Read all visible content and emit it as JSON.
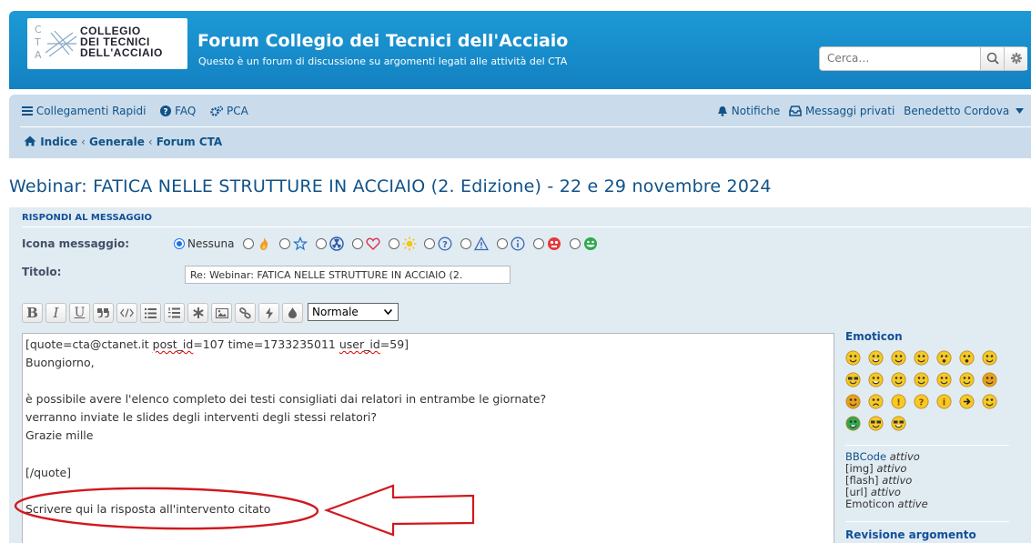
{
  "header": {
    "logo_letters": [
      "C",
      "T",
      "A"
    ],
    "logo_lines": [
      "COLLEGIO",
      "DEI TECNICI",
      "DELL'ACCIAIO"
    ],
    "title": "Forum Collegio dei Tecnici dell'Acciaio",
    "description": "Questo è un forum di discussione su argomenti legati alle attività del CTA",
    "search_placeholder": "Cerca…",
    "search_button_icon": "search-icon",
    "advanced_search_icon": "gear-icon"
  },
  "nav": {
    "quick_links": "Collegamenti Rapidi",
    "faq": "FAQ",
    "ucp": "PCA",
    "notifications": "Notifiche",
    "private_messages": "Messaggi privati",
    "username": "Benedetto Cordova",
    "breadcrumbs": [
      "Indice",
      "Generale",
      "Forum CTA"
    ]
  },
  "topic_title": "Webinar: FATICA NELLE STRUTTURE IN ACCIAIO (2. Edizione) - 22 e 29 novembre 2024",
  "form": {
    "panel_title": "RISPONDI AL MESSAGGIO",
    "icon_label": "Icona messaggio:",
    "icon_none": "Nessuna",
    "icon_options": [
      "fire-icon",
      "star-icon",
      "radioactive-icon",
      "heart-icon",
      "sun-icon",
      "question-icon",
      "warning-icon",
      "info-icon",
      "red-face-icon",
      "green-grin-icon"
    ],
    "title_label": "Titolo:",
    "title_value": "Re: Webinar: FATICA NELLE STRUTTURE IN ACCIAIO (2.",
    "toolbar": {
      "bold": "B",
      "italic": "I",
      "underline": "U",
      "font_size_selected": "Normale"
    },
    "editor_lines": {
      "l1_pre": "[quote=cta@ctanet.it ",
      "l1_post_id": "post_id",
      "l1_mid": "=107 time=1733235011 ",
      "l1_user_id": "user_id",
      "l1_end": "=59]",
      "l2": "Buongiorno,",
      "l3": "è possibile avere l'elenco completo dei testi consigliati dai relatori in entrambe le giornate?",
      "l4": "verranno inviate le slides degli interventi degli stessi relatori?",
      "l5": "Grazie mille",
      "l6": "[/quote]",
      "l7": "Scrivere qui la risposta all'intervento citato"
    }
  },
  "sidebar": {
    "emoticon_title": "Emoticon",
    "bbcode": {
      "bbcode_link": "BBCode",
      "bbcode_state": "attivo",
      "img": "[img]",
      "img_state": "attivo",
      "flash": "[flash]",
      "flash_state": "attivo",
      "url": "[url]",
      "url_state": "attivo",
      "emoticon": "Emoticon",
      "emoticon_state": "attive"
    },
    "topic_review": "Revisione argomento"
  },
  "colors": {
    "header_blue": "#1c9ad6",
    "nav_bg": "#cadceb",
    "panel_bg": "#e1ebf2",
    "link": "#105289",
    "annotation_red": "#d0191e"
  }
}
